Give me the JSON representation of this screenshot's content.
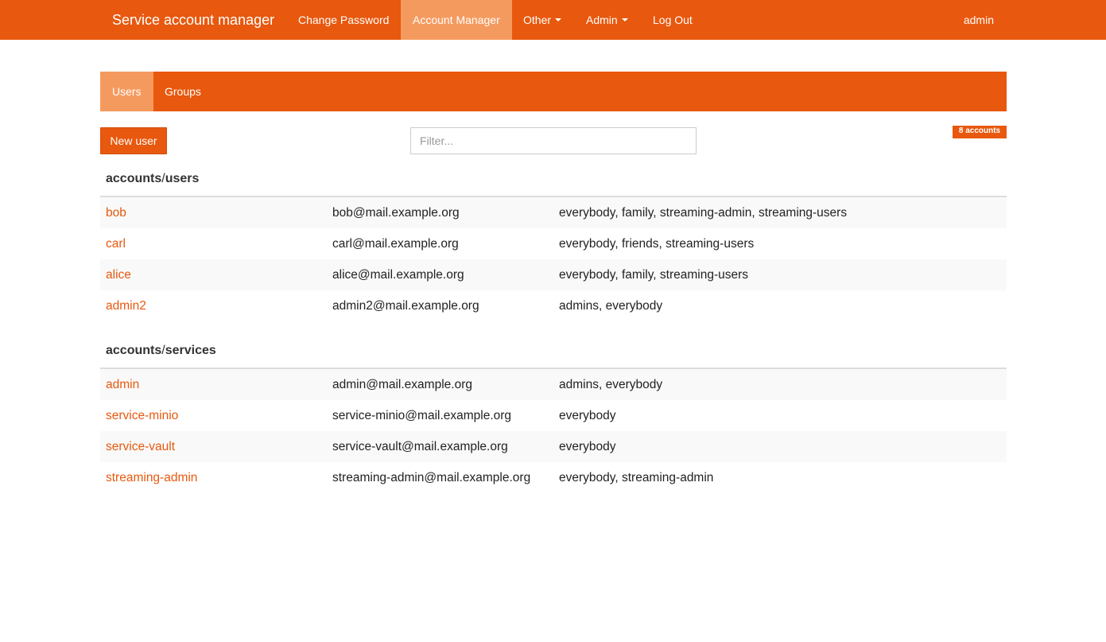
{
  "navbar": {
    "brand": "Service account manager",
    "items": [
      {
        "label": "Change Password"
      },
      {
        "label": "Account Manager"
      },
      {
        "label": "Other"
      },
      {
        "label": "Admin"
      },
      {
        "label": "Log Out"
      }
    ],
    "user": "admin",
    "accent_color": "#e8580e",
    "active_color": "#f59a5f"
  },
  "subnav": {
    "tabs": [
      {
        "label": "Users"
      },
      {
        "label": "Groups"
      }
    ]
  },
  "toolbar": {
    "new_user_label": "New user",
    "filter_placeholder": "Filter...",
    "count_badge": "8 accounts"
  },
  "sections": [
    {
      "prefix": "accounts",
      "sep": "/",
      "name": "users",
      "rows": [
        {
          "name": "bob",
          "email": "bob@mail.example.org",
          "groups": "everybody, family, streaming-admin, streaming-users"
        },
        {
          "name": "carl",
          "email": "carl@mail.example.org",
          "groups": "everybody, friends, streaming-users"
        },
        {
          "name": "alice",
          "email": "alice@mail.example.org",
          "groups": "everybody, family, streaming-users"
        },
        {
          "name": "admin2",
          "email": "admin2@mail.example.org",
          "groups": "admins, everybody"
        }
      ]
    },
    {
      "prefix": "accounts",
      "sep": "/",
      "name": "services",
      "rows": [
        {
          "name": "admin",
          "email": "admin@mail.example.org",
          "groups": "admins, everybody"
        },
        {
          "name": "service-minio",
          "email": "service-minio@mail.example.org",
          "groups": "everybody"
        },
        {
          "name": "service-vault",
          "email": "service-vault@mail.example.org",
          "groups": "everybody"
        },
        {
          "name": "streaming-admin",
          "email": "streaming-admin@mail.example.org",
          "groups": "everybody, streaming-admin"
        }
      ]
    }
  ]
}
